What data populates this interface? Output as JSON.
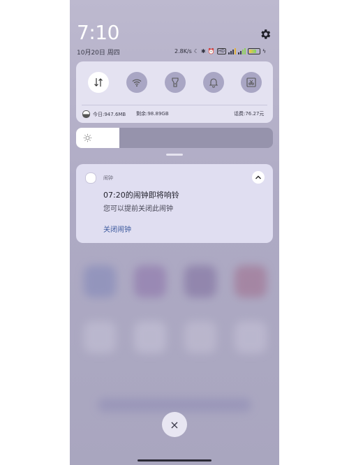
{
  "status_bar": {
    "time": "7:10",
    "date": "10月20日 周四",
    "net_speed": "2.8K/s",
    "hd_badge": "HD",
    "icons": [
      "moon-icon",
      "bluetooth-icon",
      "alarm-icon",
      "signal-icon",
      "battery-icon"
    ]
  },
  "quick_settings": {
    "tiles": [
      {
        "name": "mobile-data",
        "icon": "data-arrows-icon",
        "on": true
      },
      {
        "name": "wifi",
        "icon": "wifi-icon",
        "on": false
      },
      {
        "name": "flashlight",
        "icon": "flashlight-icon",
        "on": false
      },
      {
        "name": "sound",
        "icon": "bell-icon",
        "on": false
      },
      {
        "name": "screenshot",
        "icon": "screenshot-icon",
        "on": false
      }
    ],
    "today_data": "今日:947.6MB",
    "remaining_data": "剩余:98.89GB",
    "calls_remaining": "话费:76.27元"
  },
  "brightness": {
    "level": 0.22
  },
  "notification": {
    "app_name": "闹钟",
    "title": "07:20的闹钟即将响铃",
    "body": "您可以提前关闭此闹钟",
    "action_label": "关闭闹钟"
  },
  "dismiss": {
    "label": "×"
  },
  "colors": {
    "tile_on": "#ffffff",
    "tile_off": "#a9a6c4",
    "panel": "#e4e2f1",
    "action": "#3d5a9e"
  }
}
